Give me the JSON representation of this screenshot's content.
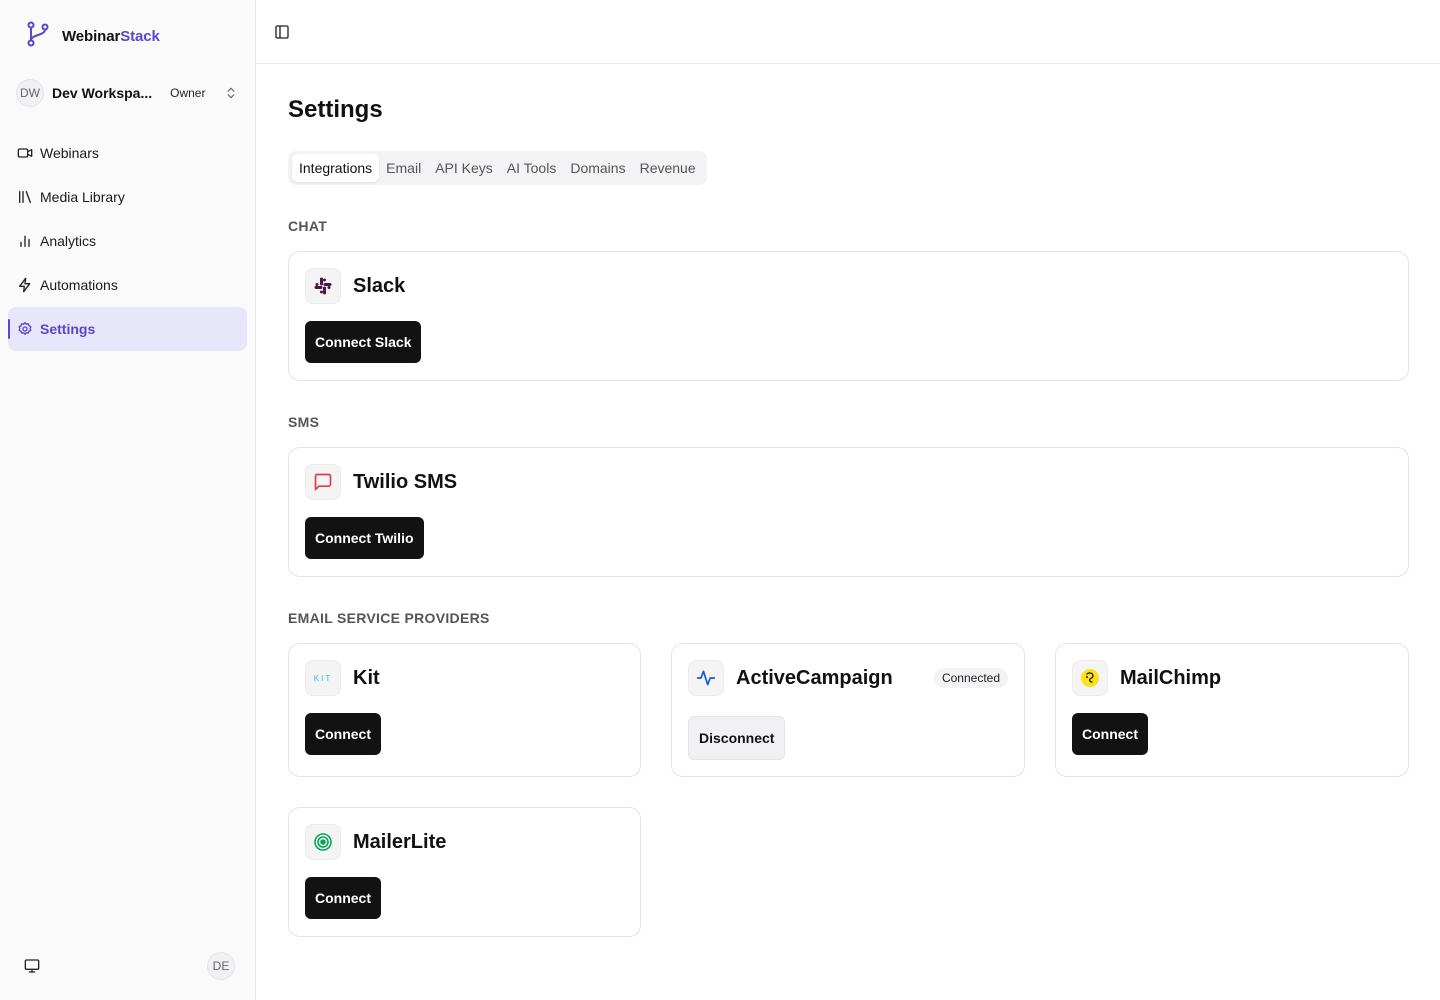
{
  "brand": {
    "name_part1": "Webinar",
    "name_part2": "Stack",
    "icon": "branch-icon"
  },
  "workspace": {
    "initials": "DW",
    "name": "Dev Workspa...",
    "role": "Owner"
  },
  "nav": {
    "items": [
      {
        "label": "Webinars",
        "icon": "video-icon"
      },
      {
        "label": "Media Library",
        "icon": "library-icon"
      },
      {
        "label": "Analytics",
        "icon": "bar-chart-icon"
      },
      {
        "label": "Automations",
        "icon": "lightning-icon"
      },
      {
        "label": "Settings",
        "icon": "gear-icon",
        "active": true
      }
    ]
  },
  "user": {
    "initials": "DE"
  },
  "page": {
    "title": "Settings"
  },
  "tabs": [
    {
      "label": "Integrations",
      "active": true
    },
    {
      "label": "Email"
    },
    {
      "label": "API Keys"
    },
    {
      "label": "AI Tools"
    },
    {
      "label": "Domains"
    },
    {
      "label": "Revenue"
    }
  ],
  "sections": {
    "chat": "CHAT",
    "sms": "SMS",
    "esp": "EMAIL SERVICE PROVIDERS"
  },
  "integrations": {
    "slack": {
      "name": "Slack",
      "button": "Connect Slack",
      "icon": "slack-icon"
    },
    "twilio": {
      "name": "Twilio SMS",
      "button": "Connect Twilio",
      "icon": "message-square-icon"
    },
    "kit": {
      "name": "Kit",
      "logo_text": "KIT",
      "button": "Connect",
      "icon": "kit-logo"
    },
    "activecampaign": {
      "name": "ActiveCampaign",
      "status": "Connected",
      "button": "Disconnect",
      "icon": "activity-icon"
    },
    "mailchimp": {
      "name": "MailChimp",
      "button": "Connect",
      "icon": "mailchimp-icon"
    },
    "mailerlite": {
      "name": "MailerLite",
      "button": "Connect",
      "icon": "mailerlite-icon"
    }
  },
  "colors": {
    "accent": "#5b45c9",
    "active_bg": "#e8e6fb",
    "primary_button": "#121212",
    "twilio": "#e03a4e",
    "activecampaign": "#1a56db",
    "mailerlite": "#09c269",
    "kit": "#25c6d9",
    "mailchimp": "#ffe01b"
  }
}
